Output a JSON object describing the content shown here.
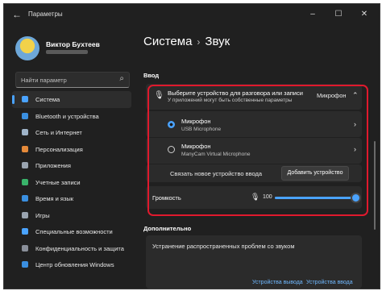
{
  "window": {
    "title": "Параметры",
    "back_icon": "arrow-left-icon",
    "controls": {
      "minimize": "–",
      "maximize": "☐",
      "close": "✕"
    }
  },
  "profile": {
    "name": "Виктор Бухтеев"
  },
  "search": {
    "placeholder": "Найти параметр"
  },
  "sidebar": {
    "items": [
      {
        "label": "Система",
        "icon": "monitor-icon",
        "color": "#4aa3ff",
        "active": true
      },
      {
        "label": "Bluetooth и устройства",
        "icon": "bluetooth-icon",
        "color": "#3a8fe0"
      },
      {
        "label": "Сеть и Интернет",
        "icon": "wifi-icon",
        "color": "#9fb4c9"
      },
      {
        "label": "Персонализация",
        "icon": "brush-icon",
        "color": "#e58a3a"
      },
      {
        "label": "Приложения",
        "icon": "apps-icon",
        "color": "#9aa4b0"
      },
      {
        "label": "Учетные записи",
        "icon": "person-icon",
        "color": "#39b36a"
      },
      {
        "label": "Время и язык",
        "icon": "globe-icon",
        "color": "#3a8fe0"
      },
      {
        "label": "Игры",
        "icon": "gamepad-icon",
        "color": "#9aa4b0"
      },
      {
        "label": "Специальные возможности",
        "icon": "accessibility-icon",
        "color": "#4aa3ff"
      },
      {
        "label": "Конфиденциальность и защита",
        "icon": "shield-icon",
        "color": "#8a8f99"
      },
      {
        "label": "Центр обновления Windows",
        "icon": "update-icon",
        "color": "#3a8fe0"
      }
    ]
  },
  "breadcrumb": {
    "parent": "Система",
    "separator": "›",
    "current": "Звук"
  },
  "input": {
    "section_title": "Ввод",
    "select": {
      "title": "Выберите устройство для разговора или записи",
      "subtitle": "У приложений могут быть собственные параметры",
      "current": "Микрофон"
    },
    "devices": [
      {
        "name": "Микрофон",
        "sub": "USB Microphone",
        "selected": true
      },
      {
        "name": "Микрофон",
        "sub": "ManyCam Virtual Microphone",
        "selected": false
      }
    ],
    "pair_label": "Связать новое устройство ввода",
    "add_button": "Добавить устройство",
    "volume": {
      "label": "Громкость",
      "value_text": "100",
      "level": 1.0
    }
  },
  "additional": {
    "section_title": "Дополнительно",
    "troubleshoot_title": "Устранение распространенных проблем со звуком",
    "links": [
      "Устройства вывода",
      "Устройства ввода"
    ]
  },
  "colors": {
    "accent": "#4aa3ff",
    "highlight": "#e0192d"
  }
}
